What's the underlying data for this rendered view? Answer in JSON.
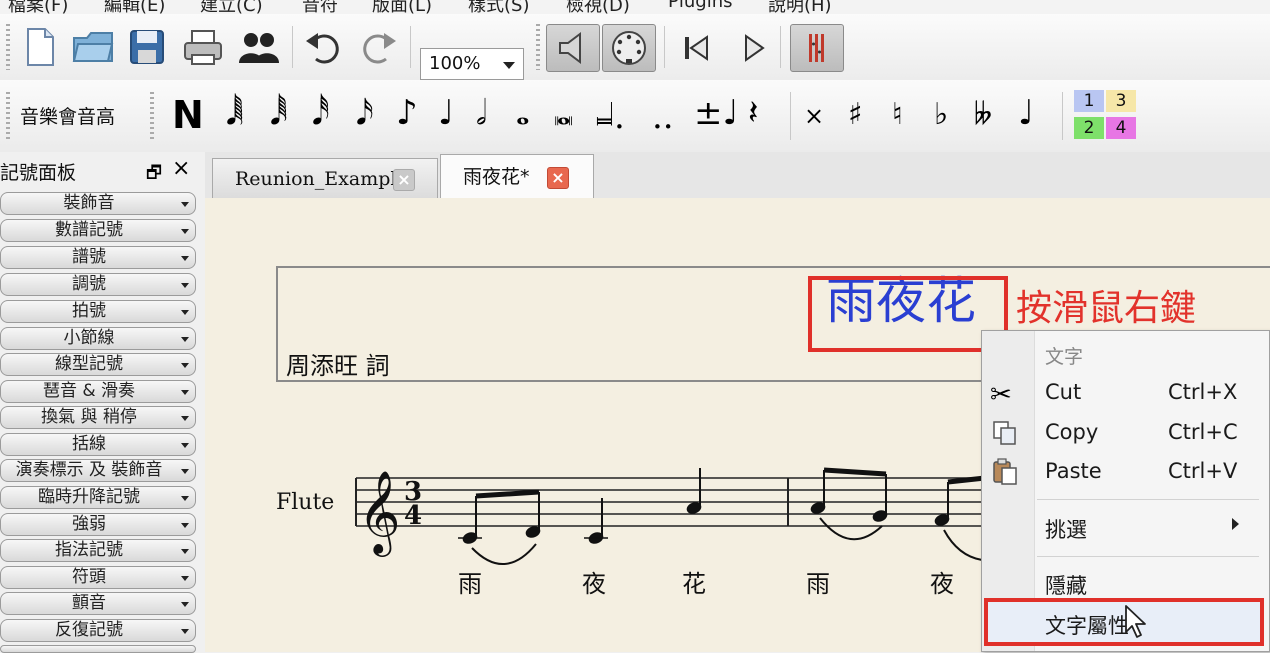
{
  "menu": [
    "檔案(F)",
    "編輯(E)",
    "建立(C)",
    "音符",
    "版面(L)",
    "樣式(S)",
    "檢視(D)",
    "Plugins",
    "說明(H)"
  ],
  "toolbar": {
    "zoom_value": "100%",
    "input_mode_label": "音樂會音高",
    "note_n_label": "N",
    "voices": [
      "1",
      "3",
      "2",
      "4"
    ],
    "voice_colors": [
      "#b9c6f2",
      "#f6e7a8",
      "#7ee06a",
      "#e776e4"
    ]
  },
  "palette": {
    "title": "記號面板",
    "items": [
      "裝飾音",
      "數譜記號",
      "譜號",
      "調號",
      "拍號",
      "小節線",
      "線型記號",
      "琶音 & 滑奏",
      "換氣 與 稍停",
      "括線",
      "演奏標示 及 裝飾音",
      "臨時升降記號",
      "強弱",
      "指法記號",
      "符頭",
      "顫音",
      "反復記號"
    ]
  },
  "tabs": [
    {
      "label": "Reunion_Example",
      "active": false
    },
    {
      "label": "雨夜花*",
      "active": true
    }
  ],
  "score": {
    "title": "雨夜花",
    "annotation": "按滑鼠右鍵",
    "lyricist": "周添旺 詞",
    "instrument": "Flute",
    "time_signature_top": "3",
    "time_signature_bottom": "4",
    "lyrics": [
      "雨",
      "夜",
      "花",
      "雨",
      "夜"
    ]
  },
  "context_menu": {
    "header": "文字",
    "cut_label": "Cut",
    "cut_shortcut": "Ctrl+X",
    "copy_label": "Copy",
    "copy_shortcut": "Ctrl+C",
    "paste_label": "Paste",
    "paste_shortcut": "Ctrl+V",
    "select_label": "挑選",
    "hide_label": "隱藏",
    "properties_label": "文字屬性"
  },
  "colors": {
    "title_blue": "#2a3fd2",
    "annotation_red": "#e2322b",
    "canvas": "#f4efe1",
    "active_tab_close": "#e8684f"
  }
}
